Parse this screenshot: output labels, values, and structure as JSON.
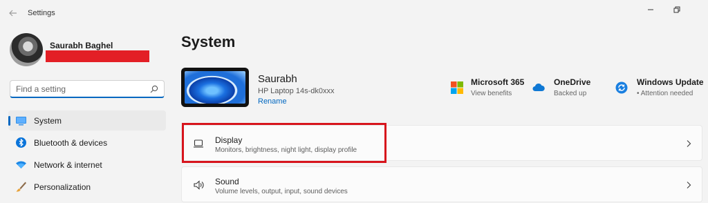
{
  "window": {
    "app_title": "Settings",
    "controls": [
      "minimize-icon",
      "restore-icon"
    ]
  },
  "profile": {
    "name": "Saurabh Baghel"
  },
  "search": {
    "placeholder": "Find a setting",
    "icon": "search-icon"
  },
  "sidebar": {
    "items": [
      {
        "label": "System",
        "icon": "monitor-icon",
        "active": true
      },
      {
        "label": "Bluetooth & devices",
        "icon": "bluetooth-icon"
      },
      {
        "label": "Network & internet",
        "icon": "wifi-icon"
      },
      {
        "label": "Personalization",
        "icon": "brush-icon"
      }
    ]
  },
  "main": {
    "title": "System",
    "device": {
      "name": "Saurabh",
      "model": "HP Laptop 14s-dk0xxx",
      "rename_label": "Rename"
    },
    "services": [
      {
        "title": "Microsoft 365",
        "subtitle": "View benefits",
        "icon": "microsoft-logo-icon"
      },
      {
        "title": "OneDrive",
        "subtitle": "Backed up",
        "icon": "cloud-icon"
      },
      {
        "title": "Windows Update",
        "subtitle": "• Attention needed",
        "icon": "update-icon"
      }
    ],
    "settings": [
      {
        "title": "Display",
        "subtitle": "Monitors, brightness, night light, display profile",
        "icon": "laptop-icon",
        "highlighted": true
      },
      {
        "title": "Sound",
        "subtitle": "Volume levels, output, input, sound devices",
        "icon": "speaker-icon"
      }
    ]
  },
  "colors": {
    "accent": "#0067c0",
    "highlight_border": "#d7141c",
    "redaction": "#e31f26",
    "background": "#f3f3f3"
  }
}
